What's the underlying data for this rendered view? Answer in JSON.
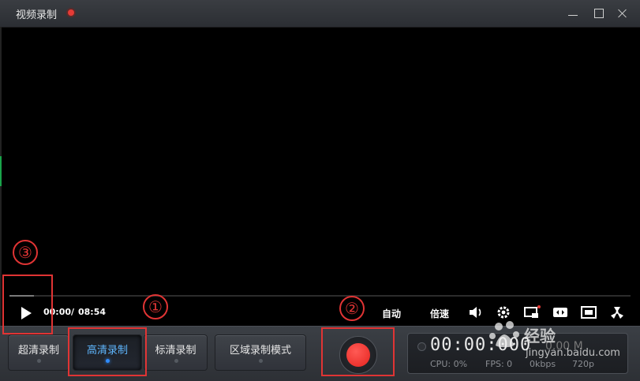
{
  "window": {
    "title": "视频录制",
    "accent_color": "#e53b36"
  },
  "player": {
    "progress_fraction": 0.04,
    "current_time": "00:00",
    "separator": "/",
    "total_time": "08:54",
    "auto_label": "自动",
    "speed_label": "倍速",
    "icons": [
      "play-icon",
      "volume-icon",
      "settings-icon",
      "picture-in-picture-icon",
      "stretch-icon",
      "fullscreen-icon",
      "radiation-icon"
    ]
  },
  "modes": [
    {
      "label": "超清录制",
      "active": false
    },
    {
      "label": "高清录制",
      "active": true
    },
    {
      "label": "标清录制",
      "active": false
    },
    {
      "label": "区域录制模式",
      "active": false
    }
  ],
  "status": {
    "time": "00:00:000",
    "size": "0.00 M",
    "cpu": "CPU: 0%",
    "fps": "FPS: 0",
    "kbps": "0kbps",
    "resolution": "720p"
  },
  "annotations": [
    "①",
    "②",
    "③"
  ],
  "watermark": {
    "text1": "经验",
    "text2": "jingyan.baidu.com"
  }
}
